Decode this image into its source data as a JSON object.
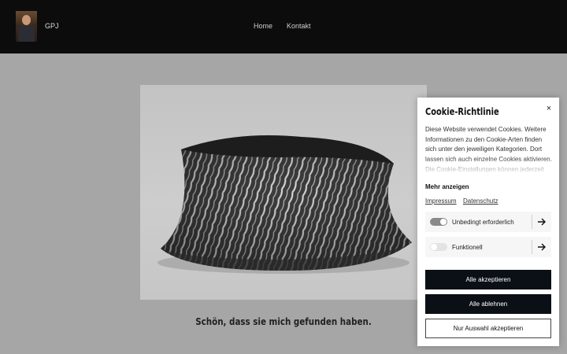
{
  "header": {
    "brand": "GPJ",
    "nav": [
      {
        "label": "Home"
      },
      {
        "label": "Kontakt"
      }
    ]
  },
  "main": {
    "tagline": "Schön, dass sie mich gefunden haben."
  },
  "cookie": {
    "title": "Cookie-Richtlinie",
    "close": "×",
    "description": "Diese Website verwendet Cookies. Weitere Informationen zu den Cookie-Arten finden sich unter den jeweiligen Kategorien. Dort lassen sich auch einzelne Cookies aktivieren. Die Cookie-Einstellungen können jederzeit",
    "more": "Mehr anzeigen",
    "links": [
      {
        "label": "Impressum"
      },
      {
        "label": "Datenschutz"
      }
    ],
    "options": [
      {
        "label": "Unbedingt erforderlich",
        "enabled": true
      },
      {
        "label": "Funktionell",
        "enabled": false
      }
    ],
    "buttons": {
      "accept_all": "Alle akzeptieren",
      "reject_all": "Alle ablehnen",
      "accept_selection": "Nur Auswahl akzeptieren"
    }
  },
  "colors": {
    "header_bg": "#0c0c0c",
    "page_bg": "#a6a6a6",
    "button_dark": "#0b0f16"
  }
}
